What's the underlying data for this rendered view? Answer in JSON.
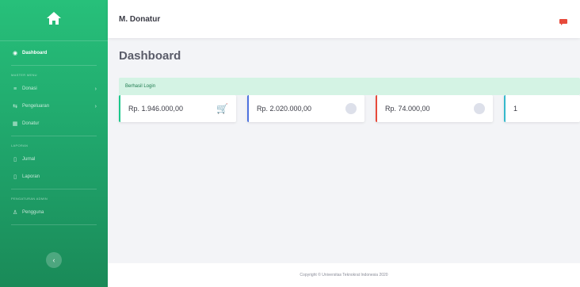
{
  "colors": {
    "sidebar": "#1fa36a",
    "alert_bg": "#d4f3e4",
    "card_green": "#1cc88a",
    "card_blue": "#4e73df",
    "card_red": "#e74a3b",
    "card_cyan": "#36b9cc",
    "notification": "#e74a3b"
  },
  "sidebar": {
    "brand_icon": "home-icon",
    "items": [
      {
        "label": "Dashboard",
        "icon": "dashboard-icon"
      },
      {
        "heading": "MASTER MENU"
      },
      {
        "label": "Donasi",
        "icon": "donate-icon"
      },
      {
        "label": "Pengeluaran",
        "icon": "expense-icon"
      },
      {
        "label": "Donatur",
        "icon": "table-icon"
      },
      {
        "heading": "LAPORAN"
      },
      {
        "label": "Jurnal",
        "icon": "journal-icon"
      },
      {
        "label": "Laporan",
        "icon": "report-icon"
      },
      {
        "heading": "PENGATURAN ADMIN"
      },
      {
        "label": "Pengguna",
        "icon": "users-icon"
      }
    ]
  },
  "topbar": {
    "title": "M. Donatur"
  },
  "main": {
    "page_title": "Dashboard",
    "alert": "Berhasil Login",
    "cards": [
      {
        "value": "Rp. 1.946.000,00",
        "icon": "cart-icon"
      },
      {
        "value": "Rp. 2.020.000,00",
        "icon": "circle-icon"
      },
      {
        "value": "Rp. 74.000,00",
        "icon": "circle-icon"
      },
      {
        "value": "1",
        "icon": ""
      }
    ]
  },
  "footer": {
    "text": "Copyright © Universitas Teknokrat Indonesia 2020"
  }
}
